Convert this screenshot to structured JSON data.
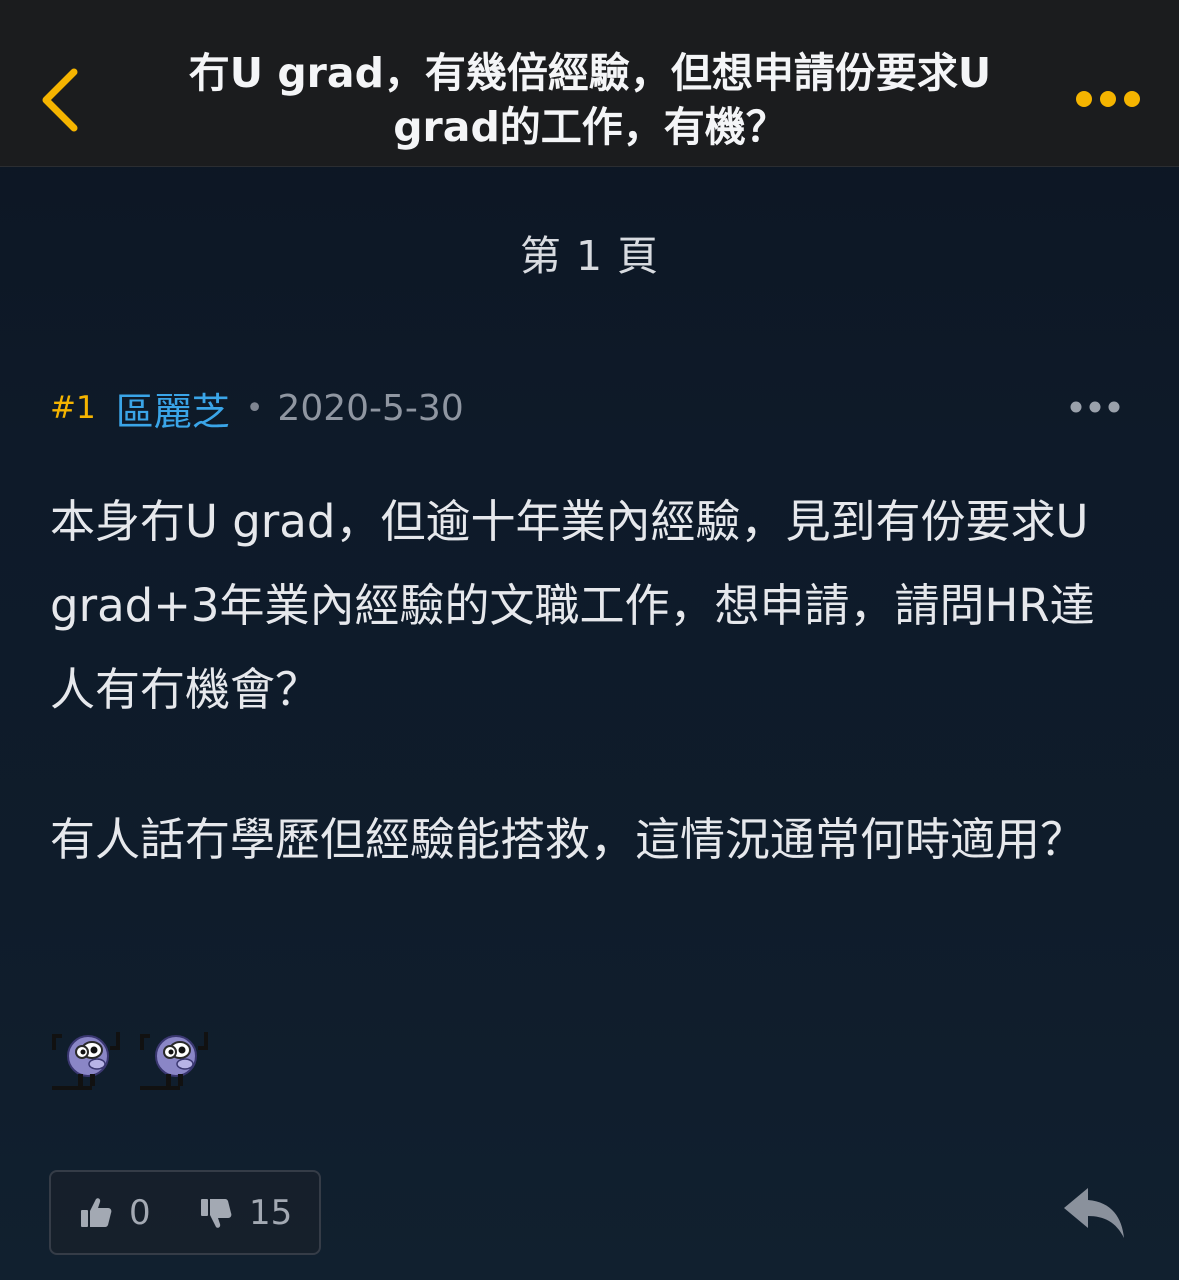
{
  "header": {
    "title": "冇U grad，有幾倍經驗，但想申請份要求U grad的工作，有機？",
    "back_icon": "chevron-left-icon",
    "more_icon": "more-dots-icon",
    "accent_color": "#f5b400"
  },
  "page_indicator": "第 1 頁",
  "post": {
    "number": "#1",
    "author": "區麗芝",
    "separator": "•",
    "date": "2020-5-30",
    "paragraphs": [
      "本身冇U grad，但逾十年業內經驗，見到有份要求U grad+3年業內經驗的文職工作，想申請，請問HR達人有冇機會？",
      "有人話冇學歷但經驗能搭救，這情況通常何時適用？"
    ],
    "stickers": [
      "pig-sticker-icon",
      "pig-sticker-icon"
    ],
    "upvotes": "0",
    "downvotes": "15",
    "author_color": "#3aa5e8",
    "number_color": "#f5b400"
  }
}
